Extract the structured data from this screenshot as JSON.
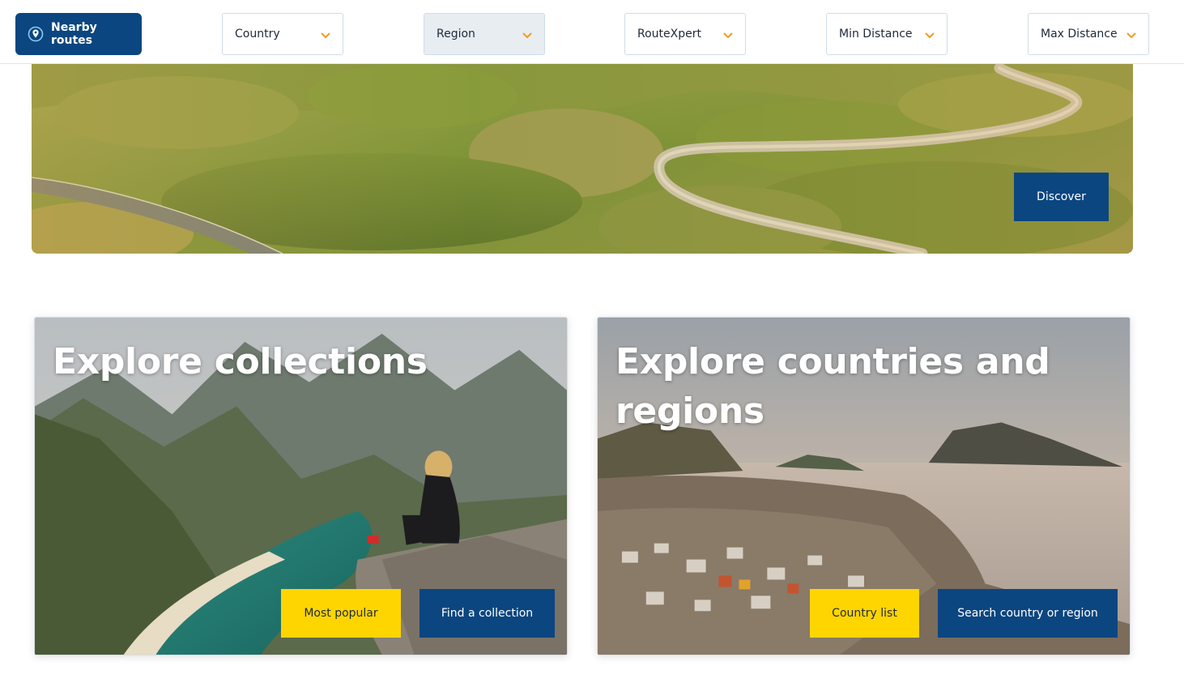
{
  "topbar": {
    "nearby_label": "Nearby routes",
    "nearby_icon": "location-pin-icon",
    "filters": [
      {
        "label": "Country",
        "icon": "chevron-down-icon"
      },
      {
        "label": "Region",
        "icon": "chevron-down-icon"
      },
      {
        "label": "RouteXpert",
        "icon": "chevron-down-icon"
      },
      {
        "label": "Min Distance",
        "icon": "chevron-down-icon"
      },
      {
        "label": "Max Distance",
        "icon": "chevron-down-icon"
      }
    ]
  },
  "hero": {
    "discover_label": "Discover"
  },
  "cards": [
    {
      "title": "Explore collections",
      "buttons": [
        "Most popular",
        "Find a collection"
      ]
    },
    {
      "title": "Explore countries and regions",
      "buttons": [
        "Country list",
        "Search country or region"
      ]
    }
  ],
  "colors": {
    "primary_blue": "#0b4680",
    "accent_yellow": "#ffd500",
    "chevron_orange": "#f29a1f",
    "border": "#cfdde9"
  }
}
